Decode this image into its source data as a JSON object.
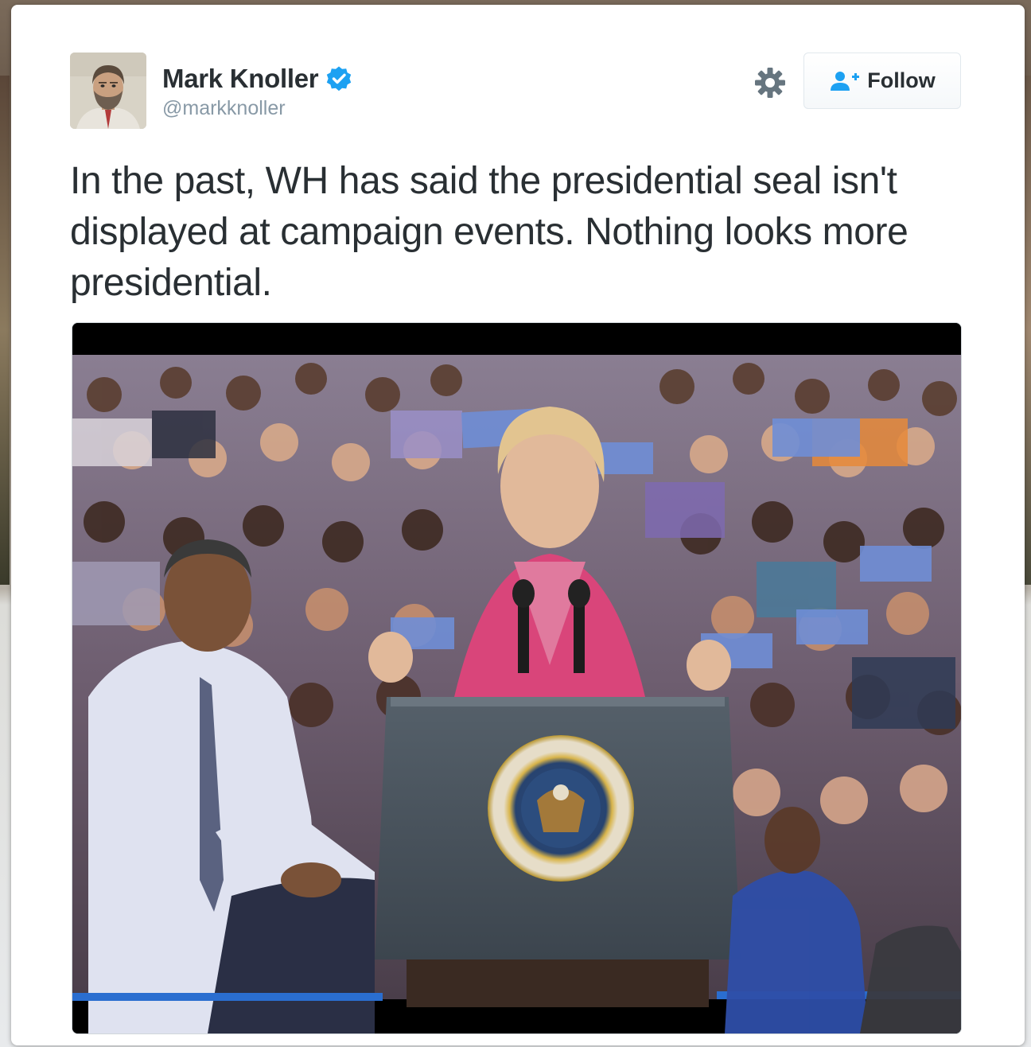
{
  "tweet": {
    "author": {
      "display_name": "Mark Knoller",
      "handle": "@markknoller",
      "verified": true,
      "avatar_icon": "profile-photo"
    },
    "text": "In the past, WH has said the presidential seal isn't displayed at campaign events. Nothing looks more presidential.",
    "actions": {
      "settings_icon": "gear-icon",
      "follow_label": "Follow",
      "follow_icon": "add-user-icon"
    },
    "media": {
      "type": "photo"
    }
  },
  "colors": {
    "text_primary": "#292f33",
    "text_secondary": "#8899a6",
    "verified_blue": "#1da1f2",
    "follow_icon_blue": "#1da1f2",
    "card_background": "#ffffff"
  }
}
